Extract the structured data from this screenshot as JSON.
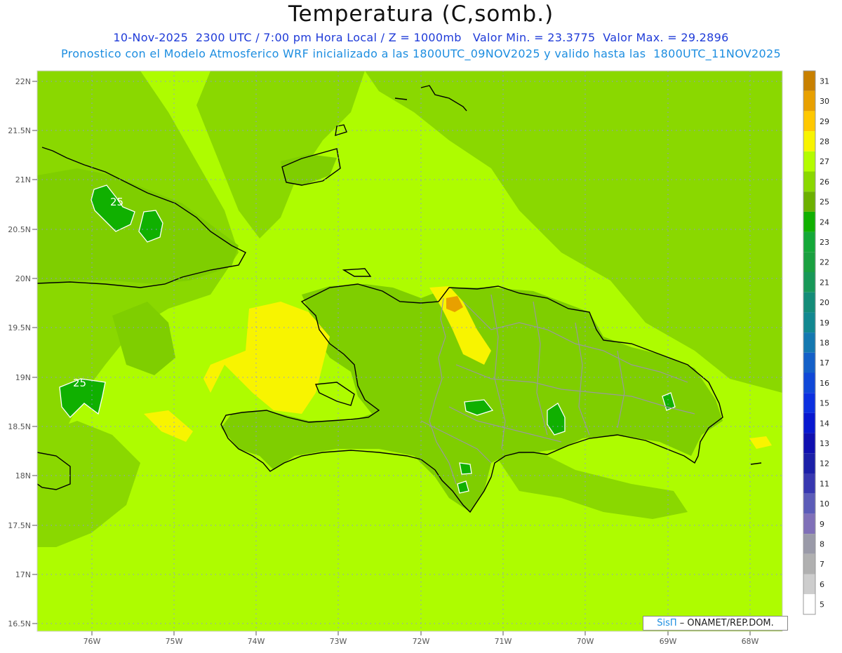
{
  "header": {
    "title": "Temperatura (C,somb.)",
    "line1": "10-Nov-2025  2300 UTC / 7:00 pm Hora Local / Z = 1000mb   Valor Min. = 23.3775  Valor Max. = 29.2896",
    "line2": "Pronostico con el Modelo Atmosferico WRF inicializado a las 1800UTC_09NOV2025 y valido hasta las  1800UTC_11NOV2025"
  },
  "map": {
    "lat_labels": [
      "22N",
      "21.5N",
      "21N",
      "20.5N",
      "20N",
      "19.5N",
      "19N",
      "18.5N",
      "18N",
      "17.5N",
      "17N",
      "16.5N"
    ],
    "lon_labels": [
      "76W",
      "75W",
      "74W",
      "73W",
      "72W",
      "71W",
      "70W",
      "69W",
      "68W"
    ],
    "contour_labels": [
      "25",
      "25"
    ],
    "background_color": "#aefc00",
    "sea_dark_color": "#8ad800",
    "land_color": "#7fce00",
    "warm_color": "#f8f400"
  },
  "colorbar": {
    "labels": [
      "31",
      "30",
      "29",
      "28",
      "27",
      "26",
      "25",
      "24",
      "23",
      "22",
      "21",
      "20",
      "19",
      "18",
      "17",
      "16",
      "15",
      "14",
      "13",
      "12",
      "11",
      "10",
      "9",
      "8",
      "7",
      "6",
      "5"
    ],
    "colors": [
      "#c88000",
      "#e8a000",
      "#ffc800",
      "#f8f400",
      "#b4fc00",
      "#8ad800",
      "#6cb000",
      "#10b000",
      "#14a838",
      "#1aa040",
      "#189858",
      "#148c78",
      "#128890",
      "#1478b0",
      "#1460c8",
      "#1048d8",
      "#0c30e0",
      "#0818d0",
      "#1010b0",
      "#1c20a8",
      "#3838b0",
      "#5c5cb8",
      "#8070b8",
      "#9a9aa8",
      "#b0b0b0",
      "#cdcdcd",
      "#ffffff"
    ]
  },
  "credit": {
    "brand": "SisΠ",
    "text": "– ONAMET/REP.DOM."
  }
}
